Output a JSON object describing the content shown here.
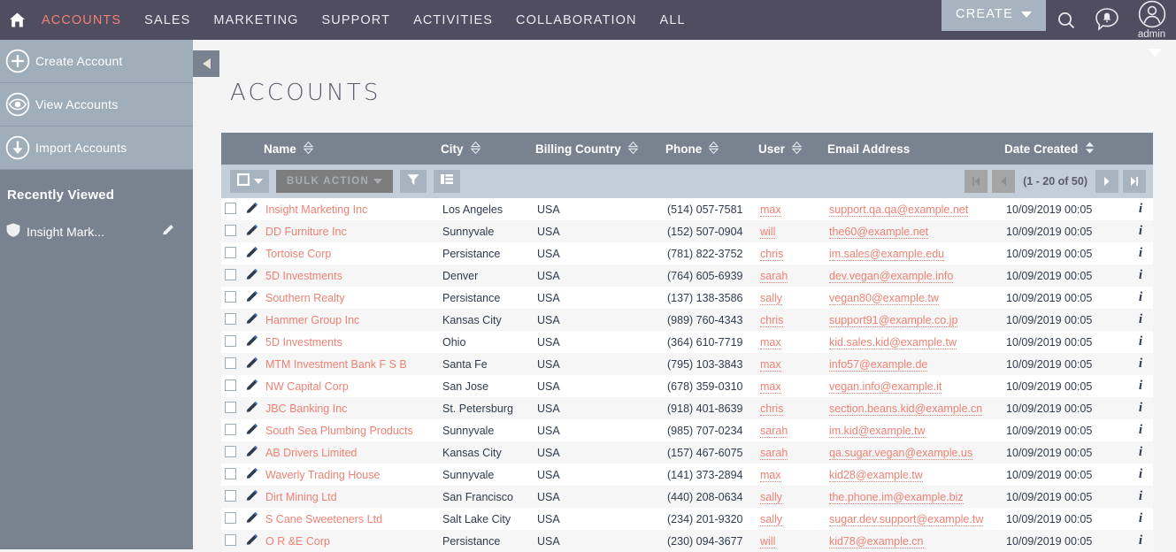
{
  "nav": {
    "home_icon": "home-icon",
    "items": [
      {
        "label": "ACCOUNTS",
        "active": true
      },
      {
        "label": "SALES",
        "active": false
      },
      {
        "label": "MARKETING",
        "active": false
      },
      {
        "label": "SUPPORT",
        "active": false
      },
      {
        "label": "ACTIVITIES",
        "active": false
      },
      {
        "label": "COLLABORATION",
        "active": false
      },
      {
        "label": "ALL",
        "active": false
      }
    ],
    "create_label": "CREATE",
    "search_icon": "search-icon",
    "notifications_icon": "notification-bell-icon",
    "avatar_icon": "user-avatar-icon",
    "admin_label": "admin",
    "accent_color": "#ef8174",
    "bar_color": "#514d61"
  },
  "sidebar": {
    "actions": [
      {
        "label": "Create Account",
        "icon": "plus-circle-icon"
      },
      {
        "label": "View Accounts",
        "icon": "eye-circle-icon"
      },
      {
        "label": "Import Accounts",
        "icon": "download-circle-icon"
      }
    ],
    "recently_viewed_title": "Recently Viewed",
    "recent_items": [
      {
        "label": "Insight Mark...",
        "icon": "shield-icon",
        "edit_icon": "pencil-icon"
      }
    ],
    "collapse_icon": "chevron-left-icon"
  },
  "main": {
    "page_title": "ACCOUNTS"
  },
  "toolbar": {
    "select_all_icon": "checkbox-dropdown-icon",
    "bulk_action_label": "BULK ACTION",
    "bulk_action_disabled": true,
    "filter_icon": "funnel-icon",
    "columns_icon": "column-list-icon",
    "pagination": {
      "first_icon": "page-first-icon",
      "prev_icon": "page-prev-icon",
      "count_label": "(1 - 20 of 50)",
      "next_icon": "page-next-icon",
      "last_icon": "page-last-icon",
      "first_disabled": true,
      "prev_disabled": true
    }
  },
  "table": {
    "columns": [
      {
        "label": "Name",
        "sortable": true,
        "active": false
      },
      {
        "label": "City",
        "sortable": true,
        "active": false
      },
      {
        "label": "Billing Country",
        "sortable": true,
        "active": false
      },
      {
        "label": "Phone",
        "sortable": true,
        "active": false
      },
      {
        "label": "User",
        "sortable": true,
        "active": false
      },
      {
        "label": "Email Address",
        "sortable": false,
        "active": false
      },
      {
        "label": "Date Created",
        "sortable": true,
        "active": true
      }
    ],
    "rows": [
      {
        "name": "Insight Marketing Inc",
        "city": "Los Angeles",
        "country": "USA",
        "phone": "(514) 057-7581",
        "user": "max",
        "email": "support.qa.qa@example.net",
        "date": "10/09/2019 00:05"
      },
      {
        "name": "DD Furniture Inc",
        "city": "Sunnyvale",
        "country": "USA",
        "phone": "(152) 507-0904",
        "user": "will",
        "email": "the60@example.net",
        "date": "10/09/2019 00:05"
      },
      {
        "name": "Tortoise Corp",
        "city": "Persistance",
        "country": "USA",
        "phone": "(781) 822-3752",
        "user": "chris",
        "email": "im.sales@example.edu",
        "date": "10/09/2019 00:05"
      },
      {
        "name": "5D Investments",
        "city": "Denver",
        "country": "USA",
        "phone": "(764) 605-6939",
        "user": "sarah",
        "email": "dev.vegan@example.info",
        "date": "10/09/2019 00:05"
      },
      {
        "name": "Southern Realty",
        "city": "Persistance",
        "country": "USA",
        "phone": "(137) 138-3586",
        "user": "sally",
        "email": "vegan80@example.tw",
        "date": "10/09/2019 00:05"
      },
      {
        "name": "Hammer Group Inc",
        "city": "Kansas City",
        "country": "USA",
        "phone": "(989) 760-4343",
        "user": "chris",
        "email": "support91@example.co.jp",
        "date": "10/09/2019 00:05"
      },
      {
        "name": "5D Investments",
        "city": "Ohio",
        "country": "USA",
        "phone": "(364) 610-7719",
        "user": "max",
        "email": "kid.sales.kid@example.tw",
        "date": "10/09/2019 00:05"
      },
      {
        "name": "MTM Investment Bank F S B",
        "city": "Santa Fe",
        "country": "USA",
        "phone": "(795) 103-3843",
        "user": "max",
        "email": "info57@example.de",
        "date": "10/09/2019 00:05"
      },
      {
        "name": "NW Capital Corp",
        "city": "San Jose",
        "country": "USA",
        "phone": "(678) 359-0310",
        "user": "max",
        "email": "vegan.info@example.it",
        "date": "10/09/2019 00:05"
      },
      {
        "name": "JBC Banking Inc",
        "city": "St. Petersburg",
        "country": "USA",
        "phone": "(918) 401-8639",
        "user": "chris",
        "email": "section.beans.kid@example.cn",
        "date": "10/09/2019 00:05"
      },
      {
        "name": "South Sea Plumbing Products",
        "city": "Sunnyvale",
        "country": "USA",
        "phone": "(985) 707-0234",
        "user": "sarah",
        "email": "im.kid@example.tw",
        "date": "10/09/2019 00:05"
      },
      {
        "name": "AB Drivers Limited",
        "city": "Kansas City",
        "country": "USA",
        "phone": "(157) 467-6075",
        "user": "sarah",
        "email": "qa.sugar.vegan@example.us",
        "date": "10/09/2019 00:05"
      },
      {
        "name": "Waverly Trading House",
        "city": "Sunnyvale",
        "country": "USA",
        "phone": "(141) 373-2894",
        "user": "max",
        "email": "kid28@example.tw",
        "date": "10/09/2019 00:05"
      },
      {
        "name": "Dirt Mining Ltd",
        "city": "San Francisco",
        "country": "USA",
        "phone": "(440) 208-0634",
        "user": "sally",
        "email": "the.phone.im@example.biz",
        "date": "10/09/2019 00:05"
      },
      {
        "name": "S Cane Sweeteners Ltd",
        "city": "Salt Lake City",
        "country": "USA",
        "phone": "(234) 201-9320",
        "user": "sally",
        "email": "sugar.dev.support@example.tw",
        "date": "10/09/2019 00:05"
      },
      {
        "name": "O R &E Corp",
        "city": "Persistance",
        "country": "USA",
        "phone": "(230) 094-3677",
        "user": "will",
        "email": "kid78@example.cn",
        "date": "10/09/2019 00:05"
      }
    ],
    "row_icons": {
      "checkbox": "row-checkbox",
      "edit": "pencil-icon",
      "info": "info-icon"
    }
  }
}
